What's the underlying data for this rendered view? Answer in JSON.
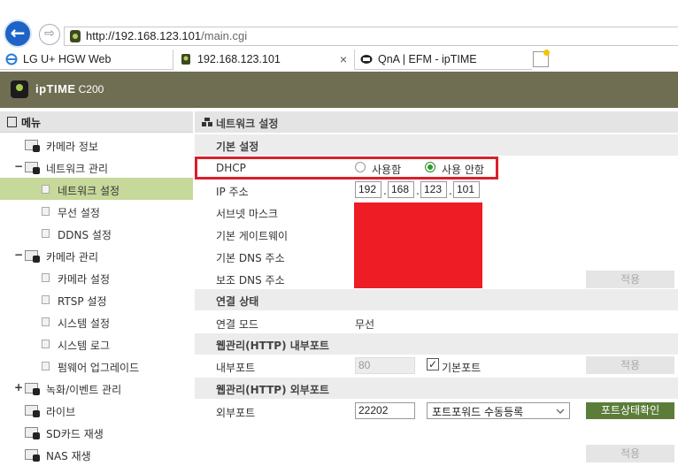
{
  "browser": {
    "url_host": "http://192.168.123.101",
    "url_path": "/main.cgi",
    "tabs": [
      {
        "label": "LG U+ HGW Web"
      },
      {
        "label": "192.168.123.101",
        "close": "×"
      },
      {
        "label": "QnA | EFM - ipTIME"
      }
    ]
  },
  "app": {
    "brand": "ipTIME",
    "model": "C200"
  },
  "menu": {
    "title": "메뉴",
    "items": [
      {
        "label": "카메라 정보"
      },
      {
        "label": "네트워크 관리",
        "toggle": "−"
      },
      {
        "label": "네트워크 설정"
      },
      {
        "label": "무선 설정"
      },
      {
        "label": "DDNS 설정"
      },
      {
        "label": "카메라 관리",
        "toggle": "−"
      },
      {
        "label": "카메라 설정"
      },
      {
        "label": "RTSP 설정"
      },
      {
        "label": "시스템 설정"
      },
      {
        "label": "시스템 로그"
      },
      {
        "label": "펌웨어 업그레이드"
      },
      {
        "label": "녹화/이벤트 관리",
        "toggle": "+"
      },
      {
        "label": "라이브"
      },
      {
        "label": "SD카드 재생"
      },
      {
        "label": "NAS 재생"
      }
    ]
  },
  "page": {
    "title": "네트워크 설정",
    "basic_header": "기본 설정",
    "dhcp_label": "DHCP",
    "dhcp_use": "사용함",
    "dhcp_nouse": "사용 안함",
    "ip_label": "IP 주소",
    "ip": [
      "192",
      "168",
      "123",
      "101"
    ],
    "subnet_label": "서브넷 마스크",
    "gateway_label": "기본 게이트웨이",
    "dns1_label": "기본 DNS 주소",
    "dns2_label": "보조 DNS 주소",
    "apply": "적용",
    "conn_header": "연결 상태",
    "conn_mode_label": "연결 모드",
    "conn_mode_value": "무선",
    "inner_header": "웹관리(HTTP) 내부포트",
    "inner_label": "내부포트",
    "inner_value": "80",
    "default_port": "기본포트",
    "outer_header": "웹관리(HTTP) 외부포트",
    "outer_label": "외부포트",
    "outer_value": "22202",
    "pf_select": "포트포워드 수동등록",
    "pf_check": "포트상태확인"
  }
}
